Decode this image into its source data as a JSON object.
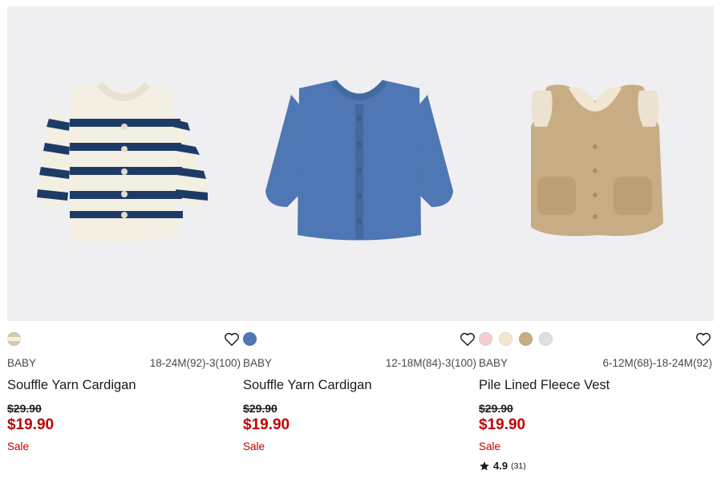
{
  "products": [
    {
      "category": "BABY",
      "sizes": "18-24M(92)-3(100)",
      "name": "Souffle Yarn Cardigan",
      "original_price": "$29.90",
      "price": "$19.90",
      "flag": "Sale",
      "swatches": [
        "#d9c8b0"
      ]
    },
    {
      "category": "BABY",
      "sizes": "12-18M(84)-3(100)",
      "name": "Souffle Yarn Cardigan",
      "original_price": "$29.90",
      "price": "$19.90",
      "flag": "Sale",
      "swatches": [
        "#4f78b3"
      ]
    },
    {
      "category": "BABY",
      "sizes": "6-12M(68)-18-24M(92)",
      "name": "Pile Lined Fleece Vest",
      "original_price": "$29.90",
      "price": "$19.90",
      "flag": "Sale",
      "swatches": [
        "#f6cfd3",
        "#f2e6d2",
        "#c8ad84",
        "#dde0e3"
      ],
      "rating": "4.9",
      "review_count": "(31)"
    }
  ],
  "colors": {
    "image_bg": "#efeff1",
    "sale_red": "#c00000",
    "navy_stripe": "#1d3b66",
    "cream": "#f4efe3",
    "denim_blue": "#4e77b3",
    "fleece_tan": "#c8ad84"
  },
  "icons": [
    "heart-icon",
    "star-icon"
  ]
}
